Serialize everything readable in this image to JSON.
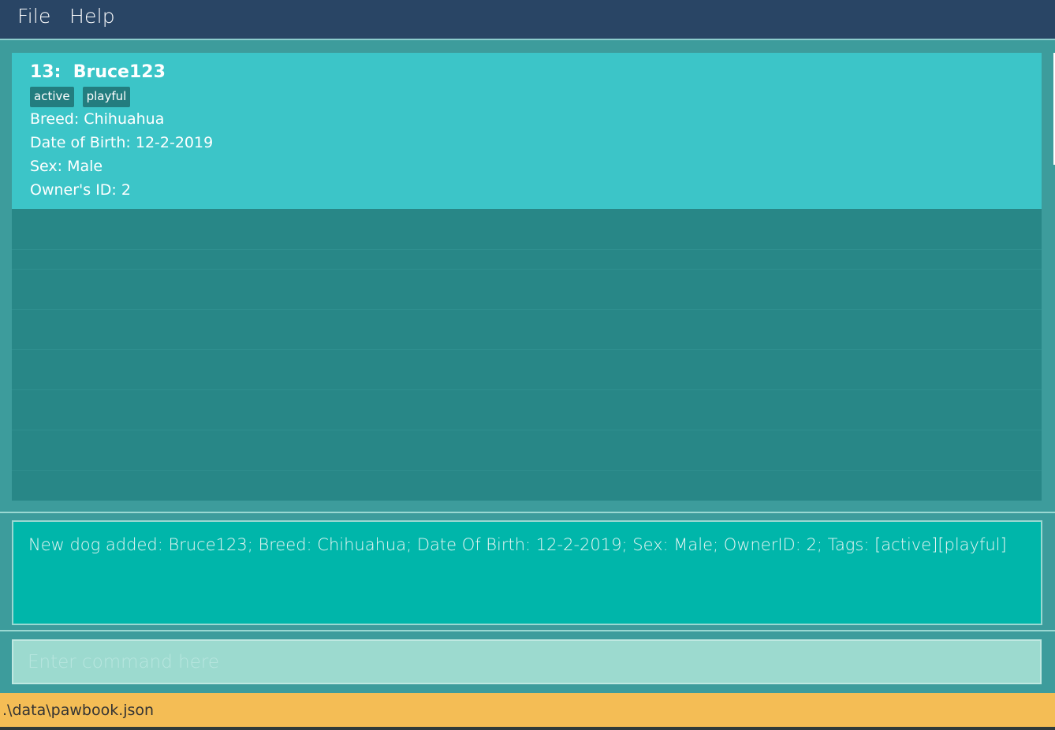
{
  "menu": {
    "file": "File",
    "help": "Help"
  },
  "dog_list": {
    "items": [
      {
        "title": "13:  Bruce123",
        "tags": [
          "active",
          "playful"
        ],
        "breed": "Breed: Chihuahua",
        "dob": "Date of Birth: 12-2-2019",
        "sex": "Sex: Male",
        "owner": "Owner's ID: 2"
      }
    ]
  },
  "result": {
    "text": "New dog added: Bruce123; Breed: Chihuahua; Date Of Birth: 12-2-2019; Sex: Male; OwnerID: 2; Tags: [active][playful]"
  },
  "command": {
    "value": "",
    "placeholder": "Enter command here"
  },
  "status": {
    "path": ".\\data\\pawbook.json"
  },
  "colors": {
    "menubar": "#294565",
    "background": "#3d9c9c",
    "card": "#3cc5c8",
    "list_bg": "#288787",
    "tag": "#237d7f",
    "result_bg": "#00b6aa",
    "command_bg": "#9cdacf",
    "statusbar": "#f4bd55"
  }
}
